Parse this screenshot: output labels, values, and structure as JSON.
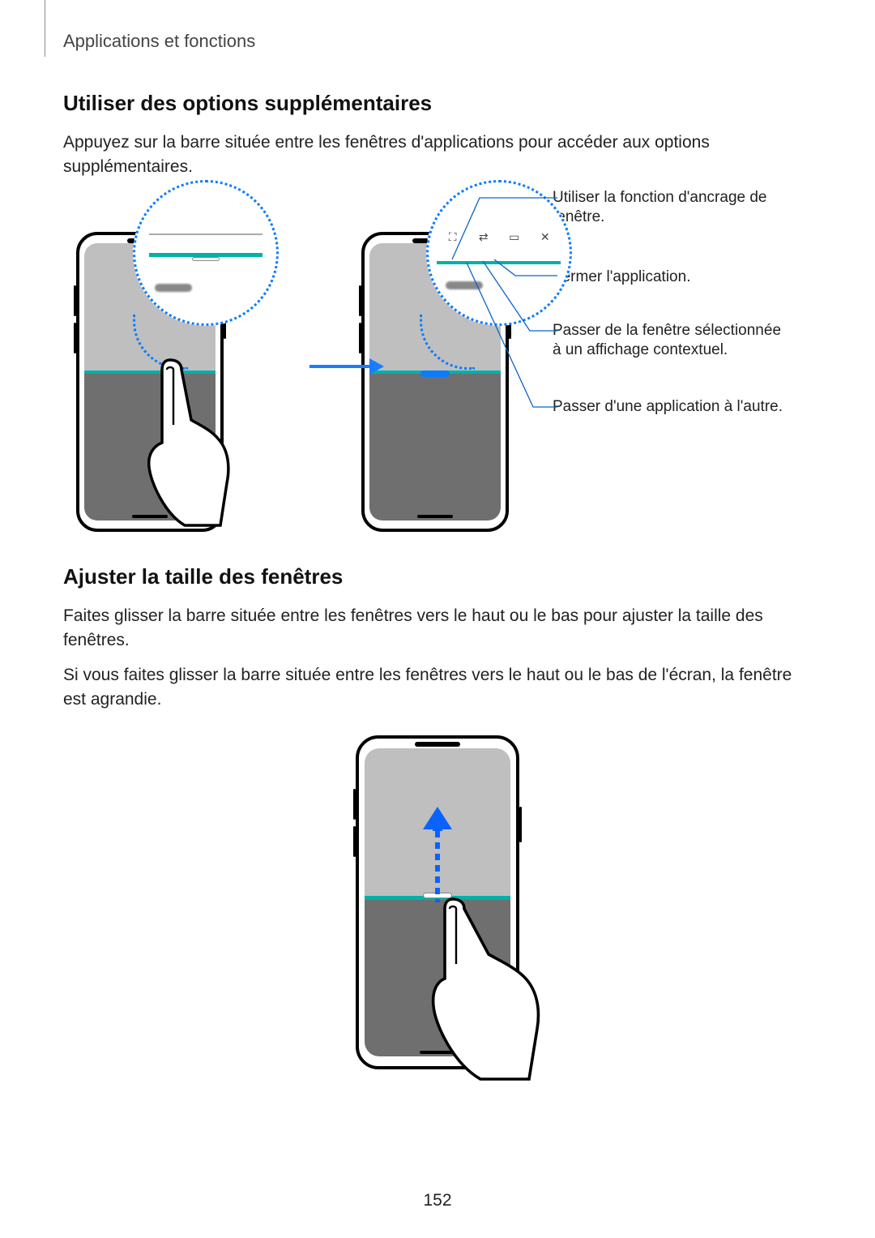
{
  "breadcrumb": "Applications et fonctions",
  "section1": {
    "heading": "Utiliser des options supplémentaires",
    "body": "Appuyez sur la barre située entre les fenêtres d'applications pour accéder aux options supplémentaires."
  },
  "callouts": {
    "c1": "Utiliser la fonction d'ancrage de fenêtre.",
    "c2": "Fermer l'application.",
    "c3": "Passer de la fenêtre sélectionnée à un affichage contextuel.",
    "c4": "Passer d'une application à l'autre."
  },
  "iconbar": {
    "anchor": "⛶",
    "swap": "⇄",
    "popup": "▭",
    "close": "✕"
  },
  "section2": {
    "heading": "Ajuster la taille des fenêtres",
    "body1": "Faites glisser la barre située entre les fenêtres vers le haut ou le bas pour ajuster la taille des fenêtres.",
    "body2": "Si vous faites glisser la barre située entre les fenêtres vers le haut ou le bas de l'écran, la fenêtre est agrandie."
  },
  "page_number": "152"
}
